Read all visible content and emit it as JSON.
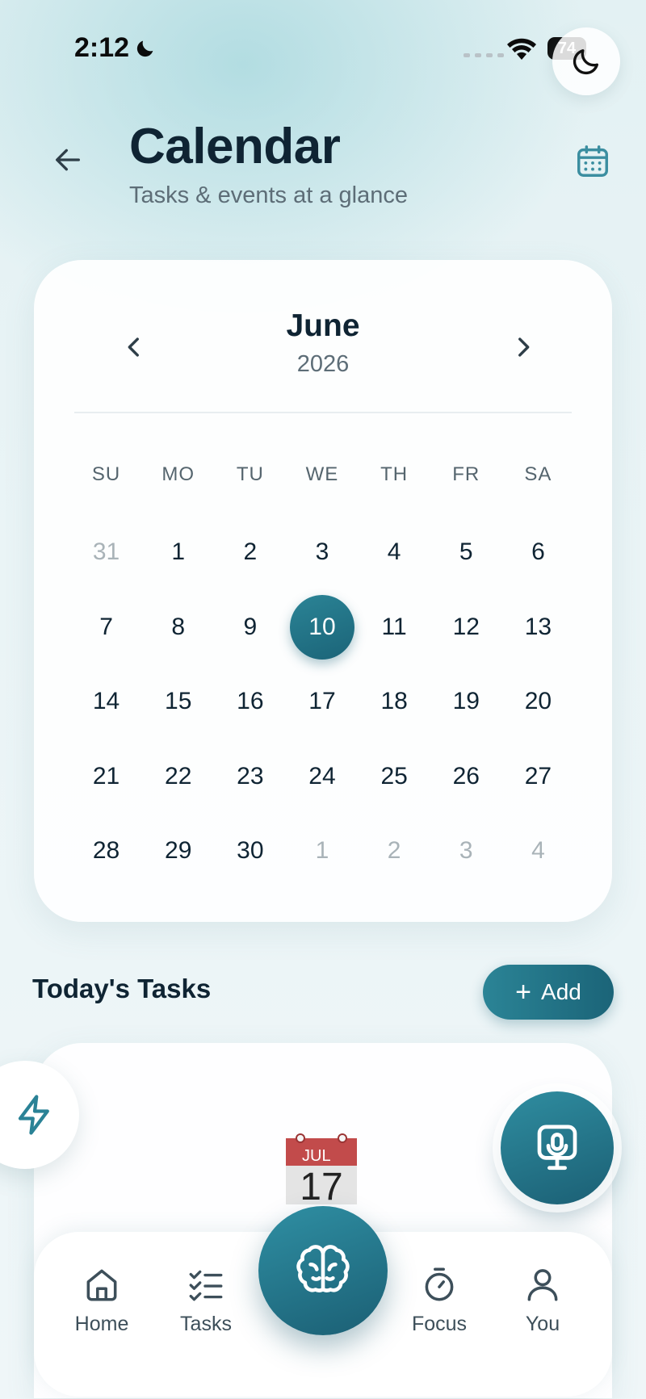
{
  "status_bar": {
    "time": "2:12",
    "battery": "74"
  },
  "header": {
    "title": "Calendar",
    "subtitle": "Tasks & events at a glance"
  },
  "calendar": {
    "month": "June",
    "year": "2026",
    "weekdays": [
      "SU",
      "MO",
      "TU",
      "WE",
      "TH",
      "FR",
      "SA"
    ],
    "days": [
      {
        "label": "31",
        "muted": true
      },
      {
        "label": "1"
      },
      {
        "label": "2"
      },
      {
        "label": "3"
      },
      {
        "label": "4"
      },
      {
        "label": "5"
      },
      {
        "label": "6"
      },
      {
        "label": "7"
      },
      {
        "label": "8"
      },
      {
        "label": "9"
      },
      {
        "label": "10",
        "selected": true
      },
      {
        "label": "11"
      },
      {
        "label": "12"
      },
      {
        "label": "13"
      },
      {
        "label": "14"
      },
      {
        "label": "15"
      },
      {
        "label": "16"
      },
      {
        "label": "17"
      },
      {
        "label": "18"
      },
      {
        "label": "19"
      },
      {
        "label": "20"
      },
      {
        "label": "21"
      },
      {
        "label": "22"
      },
      {
        "label": "23"
      },
      {
        "label": "24"
      },
      {
        "label": "25"
      },
      {
        "label": "26"
      },
      {
        "label": "27"
      },
      {
        "label": "28"
      },
      {
        "label": "29"
      },
      {
        "label": "30"
      },
      {
        "label": "1",
        "muted": true
      },
      {
        "label": "2",
        "muted": true
      },
      {
        "label": "3",
        "muted": true
      },
      {
        "label": "4",
        "muted": true
      }
    ]
  },
  "tasks": {
    "title": "Today's Tasks",
    "add_label": "Add",
    "empty_icon": {
      "month": "JUL",
      "day": "17"
    }
  },
  "bottom_nav": {
    "items": [
      {
        "label": "Home",
        "icon": "home-icon"
      },
      {
        "label": "Tasks",
        "icon": "checklist-icon"
      },
      {
        "label": "",
        "icon": "brain-icon"
      },
      {
        "label": "Focus",
        "icon": "stopwatch-icon"
      },
      {
        "label": "You",
        "icon": "user-icon"
      }
    ]
  },
  "colors": {
    "accent": "#1f6f84",
    "accent_light": "#2b8496",
    "text_primary": "#0f2433",
    "text_secondary": "#5d6d77",
    "muted_day": "#a9b3b8"
  }
}
